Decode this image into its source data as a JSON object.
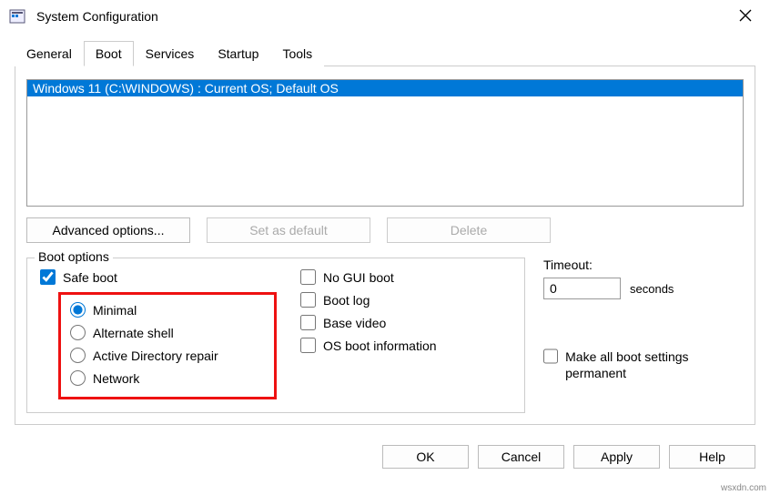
{
  "window": {
    "title": "System Configuration"
  },
  "tabs": {
    "general": "General",
    "boot": "Boot",
    "services": "Services",
    "startup": "Startup",
    "tools": "Tools",
    "active": "boot"
  },
  "os_list": {
    "item1": "Windows 11 (C:\\WINDOWS) : Current OS; Default OS"
  },
  "buttons": {
    "advanced": "Advanced options...",
    "set_default": "Set as default",
    "delete": "Delete",
    "ok": "OK",
    "cancel": "Cancel",
    "apply": "Apply",
    "help": "Help"
  },
  "boot_options": {
    "legend": "Boot options",
    "safe_boot": "Safe boot",
    "minimal": "Minimal",
    "alternate_shell": "Alternate shell",
    "ad_repair": "Active Directory repair",
    "network": "Network",
    "no_gui": "No GUI boot",
    "boot_log": "Boot log",
    "base_video": "Base video",
    "os_boot_info": "OS boot information"
  },
  "timeout": {
    "label": "Timeout:",
    "value": "0",
    "unit": "seconds"
  },
  "permanent": {
    "label": "Make all boot settings permanent"
  },
  "watermark": "wsxdn.com"
}
